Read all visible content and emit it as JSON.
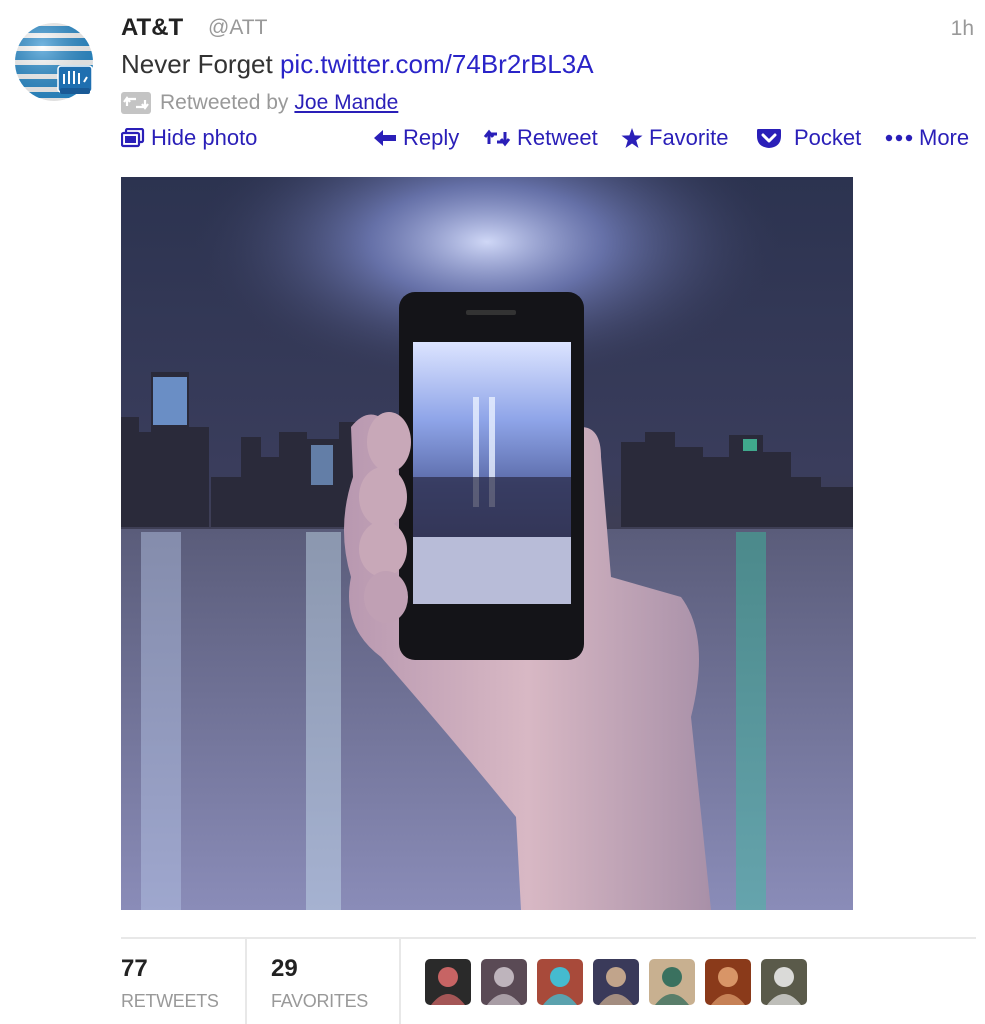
{
  "tweet": {
    "author_name": "AT&T",
    "author_handle": "@ATT",
    "timestamp": "1h",
    "text": "Never Forget",
    "link": "pic.twitter.com/74Br2rBL3A",
    "retweeted_by_prefix": "Retweeted by",
    "retweeted_by_name": "Joe Mande"
  },
  "actions": {
    "hide_photo": "Hide photo",
    "reply": "Reply",
    "retweet": "Retweet",
    "favorite": "Favorite",
    "pocket": "Pocket",
    "more": "More"
  },
  "stats": {
    "retweets_count": "77",
    "retweets_label": "RETWEETS",
    "favorites_count": "29",
    "favorites_label": "FAVORITES"
  },
  "colors": {
    "link": "#2a1fb8",
    "muted": "#999999",
    "brand_blue": "#1a8ccc"
  },
  "favoriters": [
    {
      "icon": "cartoon-avatar",
      "bg": "#2a2a2a",
      "fg": "#d86a6a"
    },
    {
      "icon": "person-avatar",
      "bg": "#5a4a55",
      "fg": "#c9c0c8"
    },
    {
      "icon": "robot-avatar",
      "bg": "#a84a3a",
      "fg": "#3ac8e0"
    },
    {
      "icon": "crowd-avatar",
      "bg": "#3a3a5a",
      "fg": "#d0b090"
    },
    {
      "icon": "person-avatar",
      "bg": "#c8b090",
      "fg": "#2a6a5a"
    },
    {
      "icon": "person-avatar",
      "bg": "#8a3a1a",
      "fg": "#e0a070"
    },
    {
      "icon": "elderly-person-avatar",
      "bg": "#5a5a4a",
      "fg": "#e8e8e8"
    }
  ]
}
